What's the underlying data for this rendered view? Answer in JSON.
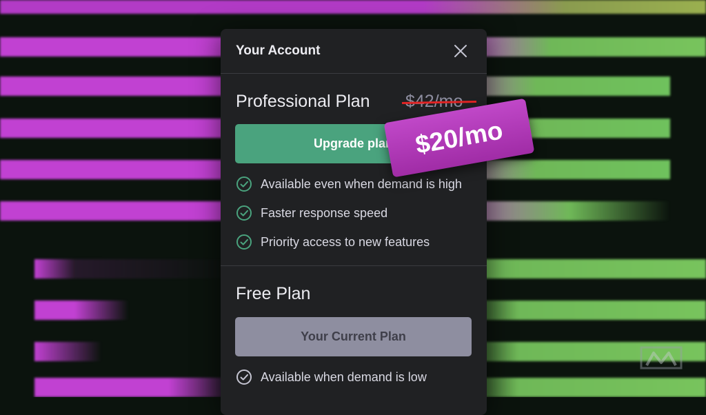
{
  "account": {
    "title": "Your Account"
  },
  "professional": {
    "name": "Professional Plan",
    "old_price": "$42/mo",
    "button_label": "Upgrade plan",
    "features": [
      "Available even when demand is high",
      "Faster response speed",
      "Priority access to new features"
    ]
  },
  "free": {
    "name": "Free Plan",
    "button_label": "Your Current Plan",
    "features": [
      "Available when demand is low"
    ]
  },
  "promo": {
    "price": "$20/mo"
  },
  "icons": {
    "close": "close-icon",
    "check": "check-circle-icon",
    "logo": "brand-logo-icon"
  },
  "colors": {
    "accent": "#4aa37e",
    "promo": "#b23bbd",
    "strike": "#e02424",
    "stripe_magenta": "#c141d2",
    "stripe_green": "#6fc25d"
  }
}
